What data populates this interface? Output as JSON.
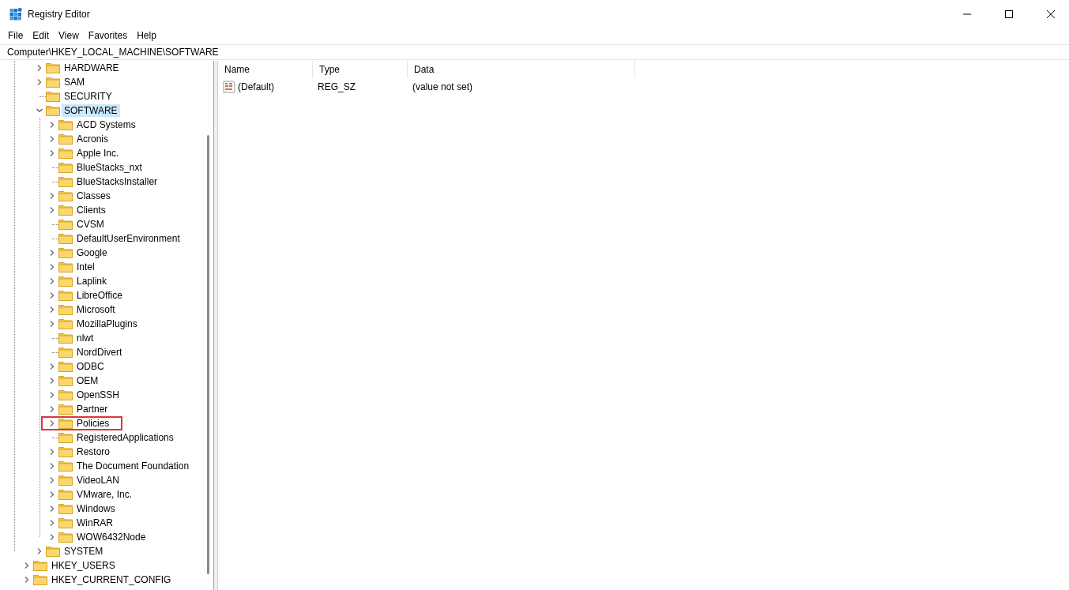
{
  "window": {
    "title": "Registry Editor"
  },
  "menu": [
    "File",
    "Edit",
    "View",
    "Favorites",
    "Help"
  ],
  "address": "Computer\\HKEY_LOCAL_MACHINE\\SOFTWARE",
  "tree": {
    "scrolled_branch": [
      {
        "name": "HARDWARE",
        "expandable": true,
        "expanded": false,
        "selected": false,
        "marked": false
      },
      {
        "name": "SAM",
        "expandable": true,
        "expanded": false,
        "selected": false,
        "marked": false
      },
      {
        "name": "SECURITY",
        "expandable": false,
        "selected": false,
        "marked": false
      },
      {
        "name": "SOFTWARE",
        "expandable": true,
        "expanded": true,
        "selected": true,
        "marked": false,
        "children": [
          {
            "name": "ACD Systems",
            "expandable": true,
            "expanded": false,
            "selected": false,
            "marked": false
          },
          {
            "name": "Acronis",
            "expandable": true,
            "expanded": false,
            "selected": false,
            "marked": false
          },
          {
            "name": "Apple Inc.",
            "expandable": true,
            "expanded": false,
            "selected": false,
            "marked": false
          },
          {
            "name": "BlueStacks_nxt",
            "expandable": false,
            "selected": false,
            "marked": false
          },
          {
            "name": "BlueStacksInstaller",
            "expandable": false,
            "selected": false,
            "marked": false
          },
          {
            "name": "Classes",
            "expandable": true,
            "expanded": false,
            "selected": false,
            "marked": false
          },
          {
            "name": "Clients",
            "expandable": true,
            "expanded": false,
            "selected": false,
            "marked": false
          },
          {
            "name": "CVSM",
            "expandable": false,
            "selected": false,
            "marked": false
          },
          {
            "name": "DefaultUserEnvironment",
            "expandable": false,
            "selected": false,
            "marked": false
          },
          {
            "name": "Google",
            "expandable": true,
            "expanded": false,
            "selected": false,
            "marked": false
          },
          {
            "name": "Intel",
            "expandable": true,
            "expanded": false,
            "selected": false,
            "marked": false
          },
          {
            "name": "Laplink",
            "expandable": true,
            "expanded": false,
            "selected": false,
            "marked": false
          },
          {
            "name": "LibreOffice",
            "expandable": true,
            "expanded": false,
            "selected": false,
            "marked": false
          },
          {
            "name": "Microsoft",
            "expandable": true,
            "expanded": false,
            "selected": false,
            "marked": false
          },
          {
            "name": "MozillaPlugins",
            "expandable": true,
            "expanded": false,
            "selected": false,
            "marked": false
          },
          {
            "name": "nlwt",
            "expandable": false,
            "selected": false,
            "marked": false
          },
          {
            "name": "NordDivert",
            "expandable": false,
            "selected": false,
            "marked": false
          },
          {
            "name": "ODBC",
            "expandable": true,
            "expanded": false,
            "selected": false,
            "marked": false
          },
          {
            "name": "OEM",
            "expandable": true,
            "expanded": false,
            "selected": false,
            "marked": false
          },
          {
            "name": "OpenSSH",
            "expandable": true,
            "expanded": false,
            "selected": false,
            "marked": false
          },
          {
            "name": "Partner",
            "expandable": true,
            "expanded": false,
            "selected": false,
            "marked": false
          },
          {
            "name": "Policies",
            "expandable": true,
            "expanded": false,
            "selected": false,
            "marked": true
          },
          {
            "name": "RegisteredApplications",
            "expandable": false,
            "selected": false,
            "marked": false
          },
          {
            "name": "Restoro",
            "expandable": true,
            "expanded": false,
            "selected": false,
            "marked": false
          },
          {
            "name": "The Document Foundation",
            "expandable": true,
            "expanded": false,
            "selected": false,
            "marked": false
          },
          {
            "name": "VideoLAN",
            "expandable": true,
            "expanded": false,
            "selected": false,
            "marked": false
          },
          {
            "name": "VMware, Inc.",
            "expandable": true,
            "expanded": false,
            "selected": false,
            "marked": false
          },
          {
            "name": "Windows",
            "expandable": true,
            "expanded": false,
            "selected": false,
            "marked": false
          },
          {
            "name": "WinRAR",
            "expandable": true,
            "expanded": false,
            "selected": false,
            "marked": false
          },
          {
            "name": "WOW6432Node",
            "expandable": true,
            "expanded": false,
            "selected": false,
            "marked": false
          }
        ]
      },
      {
        "name": "SYSTEM",
        "expandable": true,
        "expanded": false,
        "selected": false,
        "marked": false
      }
    ],
    "items": [
      {
        "name": "HKEY_USERS",
        "expandable": true,
        "expanded": false,
        "selected": false,
        "marked": false
      },
      {
        "name": "HKEY_CURRENT_CONFIG",
        "expandable": true,
        "expanded": false,
        "selected": false,
        "marked": false
      }
    ]
  },
  "values": {
    "columns": [
      "Name",
      "Type",
      "Data"
    ],
    "rows": [
      {
        "name": "(Default)",
        "type": "REG_SZ",
        "data": "(value not set)"
      }
    ]
  }
}
